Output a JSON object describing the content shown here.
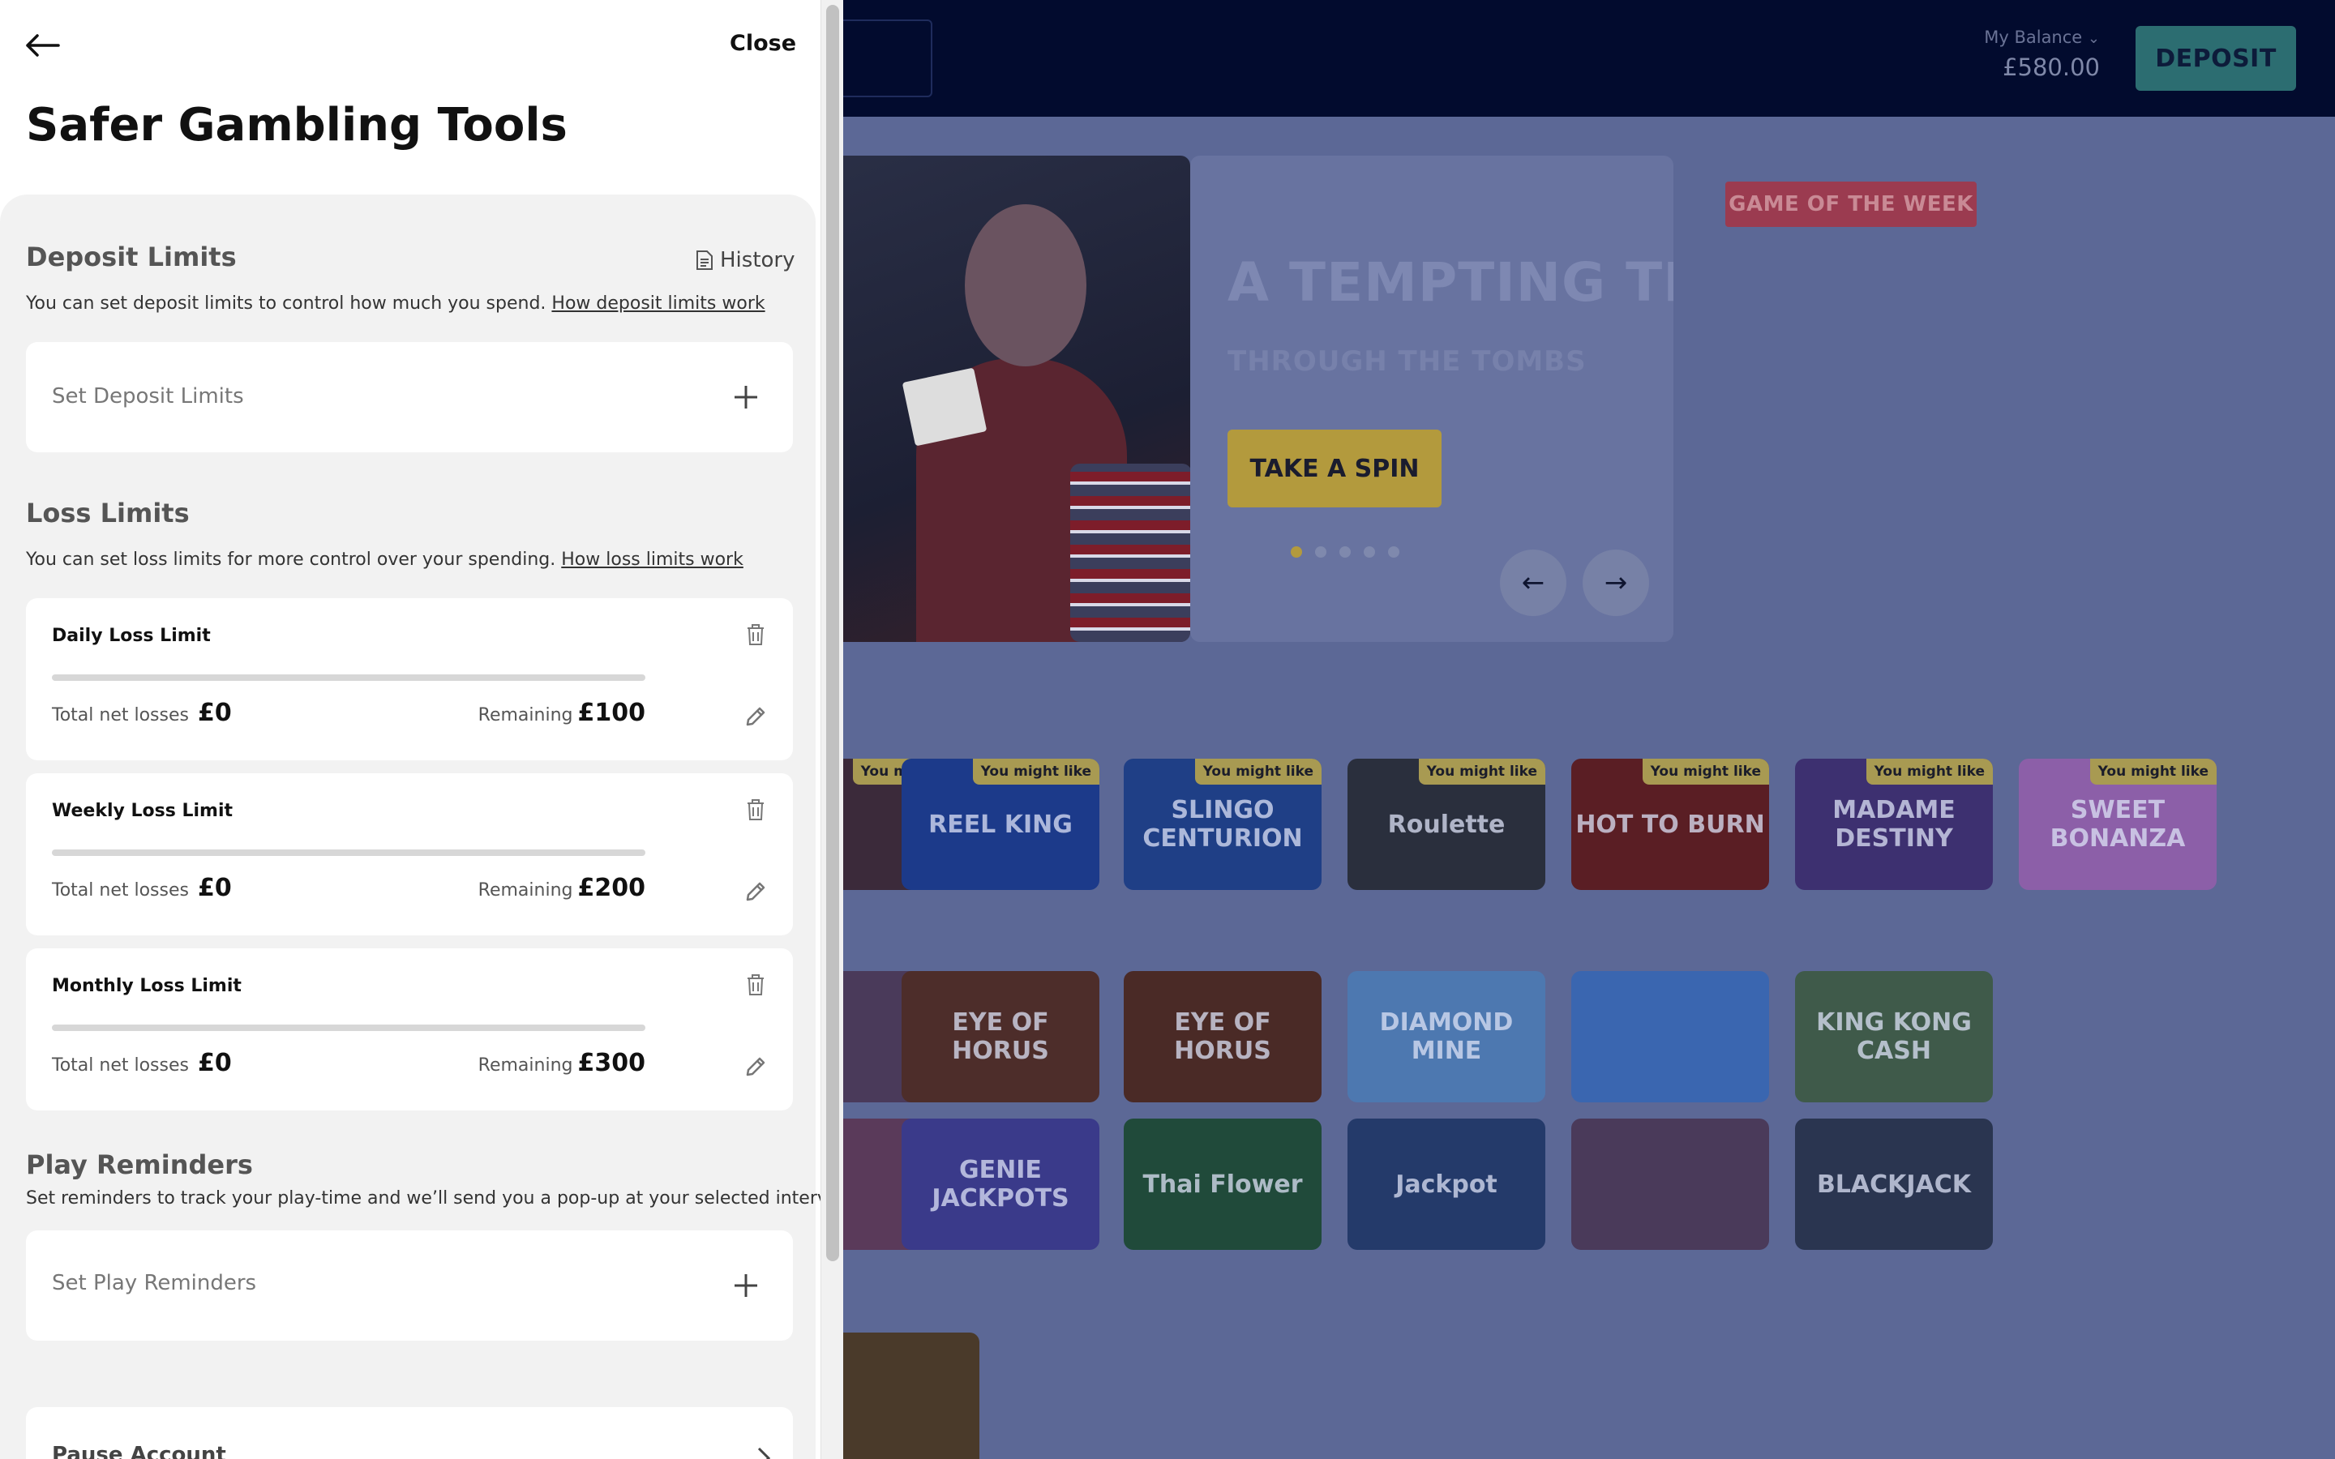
{
  "site": {
    "balance_label": "My Balance",
    "balance_value": "£580.00",
    "deposit_label": "DEPOSIT",
    "hero": {
      "title": "A TEMPTING TRE",
      "subtitle": "THROUGH THE TOMBS",
      "cta": "TAKE A SPIN",
      "active_slide": 1,
      "slide_count": 5
    },
    "game_of_week": "GAME OF THE WEEK",
    "badge_label": "You might like",
    "row1_tiles": [
      {
        "name": "",
        "color": "#3b2a3a"
      },
      {
        "name": "REEL KING",
        "color": "#1c3a8a"
      },
      {
        "name": "SLINGO CENTURION",
        "color": "#1f3f86"
      },
      {
        "name": "Roulette",
        "color": "#2a2f3d"
      },
      {
        "name": "HOT TO BURN",
        "color": "#5a1e24"
      },
      {
        "name": "MADAME DESTINY",
        "color": "#3d3070"
      },
      {
        "name": "SWEET BONANZA",
        "color": "#8c5fa8"
      }
    ],
    "row2_tiles": [
      {
        "name": "",
        "color": "#4a3a5a"
      },
      {
        "name": "EYE OF HORUS",
        "color": "#4d2d2a"
      },
      {
        "name": "EYE OF HORUS",
        "color": "#4a2a26"
      },
      {
        "name": "DIAMOND MINE",
        "color": "#4d78b0"
      },
      {
        "name": "",
        "color": "#3a66b0"
      },
      {
        "name": "KING KONG CASH",
        "color": "#3f5a4a"
      }
    ],
    "row3_tiles": [
      {
        "name": "",
        "color": "#5a3a5a"
      },
      {
        "name": "GENIE JACKPOTS",
        "color": "#3a3a8a"
      },
      {
        "name": "Thai Flower",
        "color": "#204a3a"
      },
      {
        "name": "Jackpot",
        "color": "#243a6a"
      },
      {
        "name": "",
        "color": "#4a3a5a"
      },
      {
        "name": "BLACKJACK",
        "color": "#2a3550"
      }
    ]
  },
  "panel": {
    "close_label": "Close",
    "title": "Safer Gambling Tools",
    "deposit": {
      "heading": "Deposit Limits",
      "history_label": "History",
      "desc": "You can set deposit limits to control how much you spend.",
      "link": "How deposit limits work",
      "set_label": "Set Deposit Limits"
    },
    "loss": {
      "heading": "Loss Limits",
      "desc": "You can set loss limits for more control over your spending.",
      "link": "How loss limits work",
      "net_label": "Total net losses",
      "remaining_label": "Remaining",
      "limits": [
        {
          "title": "Daily Loss Limit",
          "net": "£0",
          "remaining": "£100",
          "progress": 0
        },
        {
          "title": "Weekly Loss Limit",
          "net": "£0",
          "remaining": "£200",
          "progress": 0
        },
        {
          "title": "Monthly Loss Limit",
          "net": "£0",
          "remaining": "£300",
          "progress": 0
        }
      ]
    },
    "reminders": {
      "heading": "Play Reminders",
      "desc": "Set reminders to track your play-time and we’ll send you a pop-up at your selected interval.",
      "set_label": "Set Play Reminders"
    },
    "pause": {
      "label": "Pause Account"
    }
  }
}
